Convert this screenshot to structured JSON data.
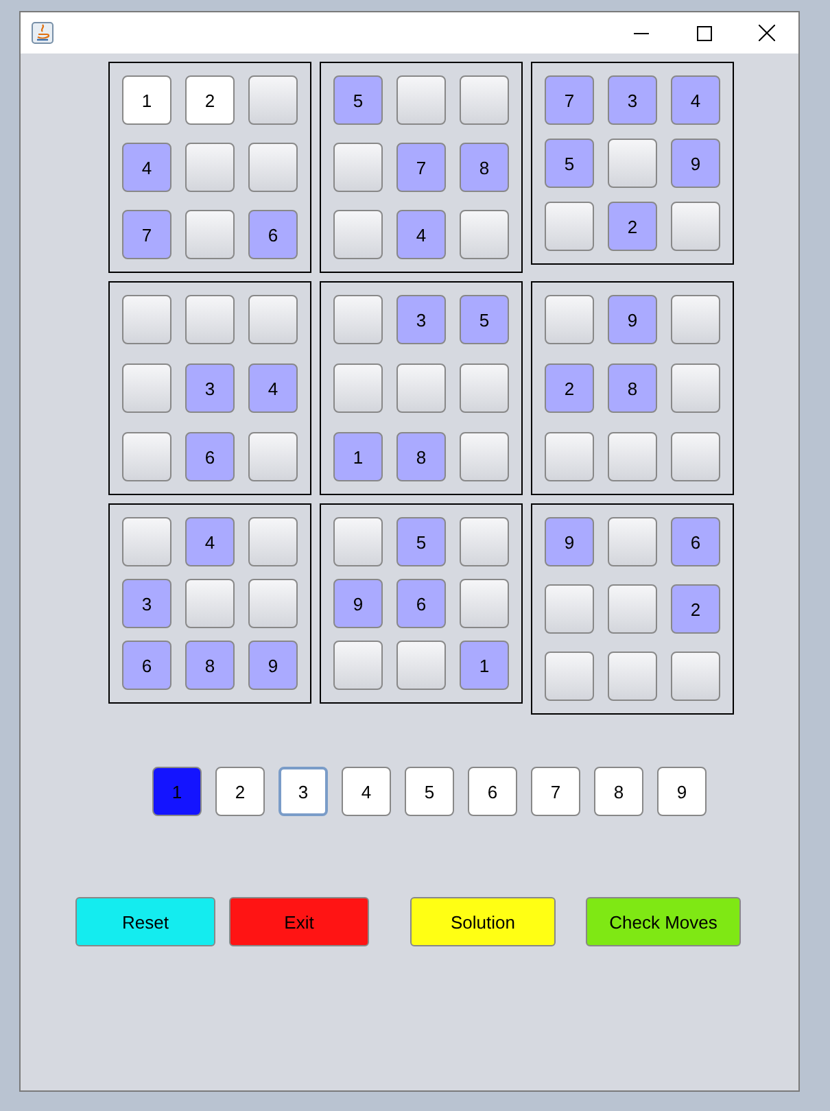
{
  "boxes": [
    {
      "cells": [
        {
          "kind": "user",
          "value": "1"
        },
        {
          "kind": "user",
          "value": "2"
        },
        {
          "kind": "empty"
        },
        {
          "kind": "given",
          "value": "4"
        },
        {
          "kind": "empty"
        },
        {
          "kind": "empty"
        },
        {
          "kind": "given",
          "value": "7"
        },
        {
          "kind": "empty"
        },
        {
          "kind": "given",
          "value": "6"
        }
      ]
    },
    {
      "cells": [
        {
          "kind": "given",
          "value": "5"
        },
        {
          "kind": "empty"
        },
        {
          "kind": "empty"
        },
        {
          "kind": "empty"
        },
        {
          "kind": "given",
          "value": "7"
        },
        {
          "kind": "given",
          "value": "8"
        },
        {
          "kind": "empty"
        },
        {
          "kind": "given",
          "value": "4"
        },
        {
          "kind": "empty"
        }
      ]
    },
    {
      "cells": [
        {
          "kind": "given",
          "value": "7"
        },
        {
          "kind": "given",
          "value": "3"
        },
        {
          "kind": "given",
          "value": "4"
        },
        {
          "kind": "given",
          "value": "5"
        },
        {
          "kind": "empty"
        },
        {
          "kind": "given",
          "value": "9"
        },
        {
          "kind": "empty"
        },
        {
          "kind": "given",
          "value": "2"
        },
        {
          "kind": "empty"
        }
      ]
    },
    {
      "cells": [
        {
          "kind": "empty"
        },
        {
          "kind": "empty"
        },
        {
          "kind": "empty"
        },
        {
          "kind": "empty"
        },
        {
          "kind": "given",
          "value": "3"
        },
        {
          "kind": "given",
          "value": "4"
        },
        {
          "kind": "empty"
        },
        {
          "kind": "given",
          "value": "6"
        },
        {
          "kind": "empty"
        }
      ]
    },
    {
      "cells": [
        {
          "kind": "empty"
        },
        {
          "kind": "given",
          "value": "3"
        },
        {
          "kind": "given",
          "value": "5"
        },
        {
          "kind": "empty"
        },
        {
          "kind": "empty"
        },
        {
          "kind": "empty"
        },
        {
          "kind": "given",
          "value": "1"
        },
        {
          "kind": "given",
          "value": "8"
        },
        {
          "kind": "empty"
        }
      ]
    },
    {
      "cells": [
        {
          "kind": "empty"
        },
        {
          "kind": "given",
          "value": "9"
        },
        {
          "kind": "empty"
        },
        {
          "kind": "given",
          "value": "2"
        },
        {
          "kind": "given",
          "value": "8"
        },
        {
          "kind": "empty"
        },
        {
          "kind": "empty"
        },
        {
          "kind": "empty"
        },
        {
          "kind": "empty"
        }
      ]
    },
    {
      "cells": [
        {
          "kind": "empty"
        },
        {
          "kind": "given",
          "value": "4"
        },
        {
          "kind": "empty"
        },
        {
          "kind": "given",
          "value": "3"
        },
        {
          "kind": "empty"
        },
        {
          "kind": "empty"
        },
        {
          "kind": "given",
          "value": "6"
        },
        {
          "kind": "given",
          "value": "8"
        },
        {
          "kind": "given",
          "value": "9"
        }
      ]
    },
    {
      "cells": [
        {
          "kind": "empty"
        },
        {
          "kind": "given",
          "value": "5"
        },
        {
          "kind": "empty"
        },
        {
          "kind": "given",
          "value": "9"
        },
        {
          "kind": "given",
          "value": "6"
        },
        {
          "kind": "empty"
        },
        {
          "kind": "empty"
        },
        {
          "kind": "empty"
        },
        {
          "kind": "given",
          "value": "1"
        }
      ]
    },
    {
      "cells": [
        {
          "kind": "given",
          "value": "9"
        },
        {
          "kind": "empty"
        },
        {
          "kind": "given",
          "value": "6"
        },
        {
          "kind": "empty"
        },
        {
          "kind": "empty"
        },
        {
          "kind": "given",
          "value": "2"
        },
        {
          "kind": "empty"
        },
        {
          "kind": "empty"
        },
        {
          "kind": "empty"
        }
      ]
    }
  ],
  "number_picker": [
    {
      "label": "1",
      "selected": true,
      "focused": false
    },
    {
      "label": "2",
      "selected": false,
      "focused": false
    },
    {
      "label": "3",
      "selected": false,
      "focused": true
    },
    {
      "label": "4",
      "selected": false,
      "focused": false
    },
    {
      "label": "5",
      "selected": false,
      "focused": false
    },
    {
      "label": "6",
      "selected": false,
      "focused": false
    },
    {
      "label": "7",
      "selected": false,
      "focused": false
    },
    {
      "label": "8",
      "selected": false,
      "focused": false
    },
    {
      "label": "9",
      "selected": false,
      "focused": false
    }
  ],
  "buttons": [
    {
      "label": "Reset",
      "color": "#14ecef"
    },
    {
      "label": "Exit",
      "color": "#ff1414"
    },
    {
      "label": "Solution",
      "color": "#ffff14"
    },
    {
      "label": "Check Moves",
      "color": "#7fe814"
    }
  ]
}
